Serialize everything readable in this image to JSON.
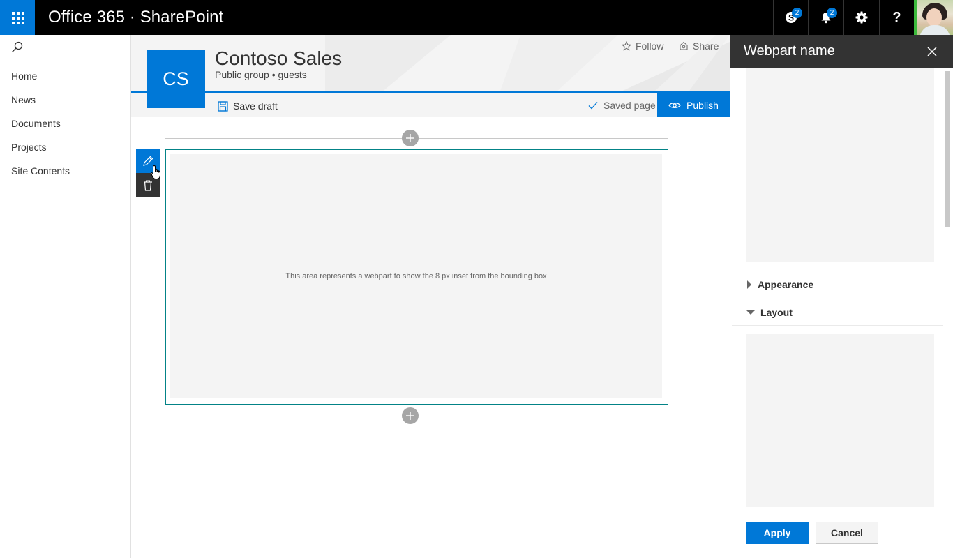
{
  "suitebar": {
    "title": "Office 365 · SharePoint",
    "skype_badge": "2",
    "bell_badge": "2",
    "help_label": "?",
    "accent": "#0078d7"
  },
  "leftnav": {
    "items": [
      {
        "label": "Home"
      },
      {
        "label": "News"
      },
      {
        "label": "Documents"
      },
      {
        "label": "Projects"
      },
      {
        "label": "Site Contents"
      }
    ]
  },
  "site": {
    "logo_text": "CS",
    "title": "Contoso Sales",
    "subtitle": "Public group • guests",
    "follow_label": "Follow",
    "share_label": "Share"
  },
  "commandbar": {
    "save_draft": "Save draft",
    "saved_status": "Saved page",
    "publish": "Publish"
  },
  "canvas": {
    "webpart_text": "This area represents a webpart to show the 8 px inset from the bounding box"
  },
  "pane": {
    "title": "Webpart name",
    "groups": [
      {
        "label": "Appearance",
        "expanded": false
      },
      {
        "label": "Layout",
        "expanded": true
      }
    ],
    "apply_label": "Apply",
    "cancel_label": "Cancel"
  }
}
